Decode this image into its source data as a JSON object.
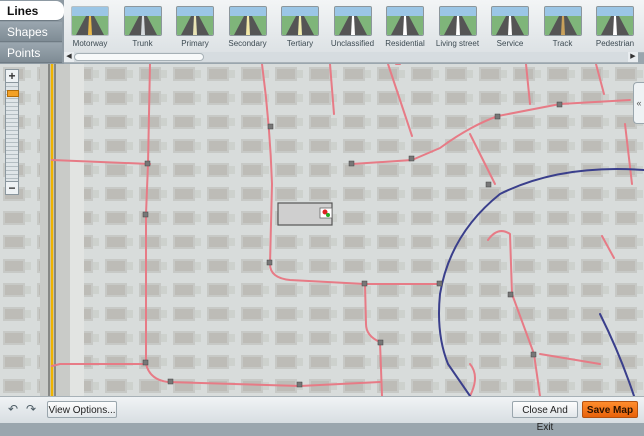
{
  "tabs": [
    {
      "label": "Lines",
      "active": true
    },
    {
      "label": "Shapes",
      "active": false
    },
    {
      "label": "Points",
      "active": false
    }
  ],
  "road_types": [
    {
      "label": "Motorway",
      "icon": "motorway-road-icon",
      "color": "#e8b84a"
    },
    {
      "label": "Trunk",
      "icon": "trunk-road-icon",
      "color": "#d7dce0"
    },
    {
      "label": "Primary",
      "icon": "primary-road-icon",
      "color": "#e9e4b5"
    },
    {
      "label": "Secondary",
      "icon": "secondary-road-icon",
      "color": "#f2e8a8"
    },
    {
      "label": "Tertiary",
      "icon": "tertiary-road-icon",
      "color": "#f3eeb0"
    },
    {
      "label": "Unclassified",
      "icon": "unclassified-road-icon",
      "color": "#ffffff"
    },
    {
      "label": "Residential",
      "icon": "residential-road-icon",
      "color": "#ffffff"
    },
    {
      "label": "Living street",
      "icon": "living-street-icon",
      "color": "#ffffff"
    },
    {
      "label": "Service",
      "icon": "service-road-icon",
      "color": "#ffffff"
    },
    {
      "label": "Track",
      "icon": "track-road-icon",
      "color": "#c9a15b"
    },
    {
      "label": "Pedestrian",
      "icon": "pedestrian-road-icon",
      "color": "#ffffff"
    }
  ],
  "zoom": {
    "plus": "+",
    "minus": "−",
    "level": 0.92
  },
  "collapse_glyph": "«",
  "bottom": {
    "undo": "↶",
    "redo": "↷",
    "view_options": "View Options...",
    "close_exit": "Close And Exit",
    "save_map": "Save Map"
  },
  "colors": {
    "accent": "#f07716",
    "residential_road": "#e77b86",
    "tertiary_road": "#3a3f8c",
    "motorway": "#f0b400"
  }
}
